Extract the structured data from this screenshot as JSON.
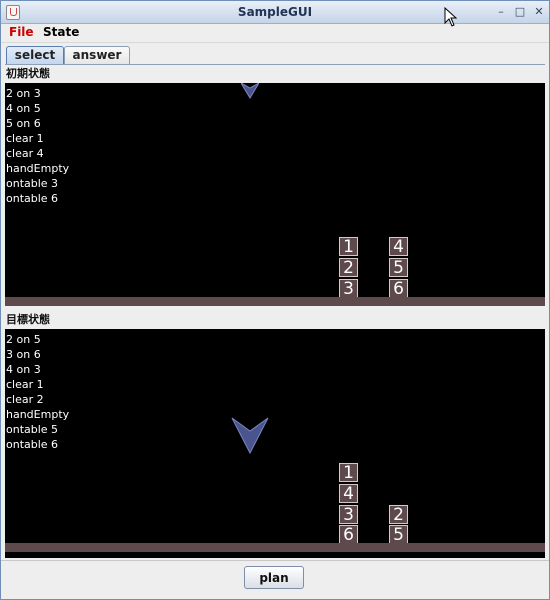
{
  "window": {
    "title": "SampleGUI",
    "minimize": "–",
    "maximize": "□",
    "close": "✕"
  },
  "menu": {
    "file": "File",
    "state": "State",
    "file_color": "#cc0000"
  },
  "tabs": {
    "select": "select",
    "answer": "answer"
  },
  "initial": {
    "label": "初期状態",
    "facts": [
      "2 on 3",
      "4 on 5",
      "5 on 6",
      "clear 1",
      "clear 4",
      "handEmpty",
      "ontable 3",
      "ontable 6"
    ],
    "stacks": [
      [
        "1",
        "2",
        "3"
      ],
      [
        "4",
        "5",
        "6"
      ]
    ]
  },
  "goal": {
    "label": "目標状態",
    "facts": [
      "2 on 5",
      "3 on 6",
      "4 on 3",
      "clear 1",
      "clear 2",
      "handEmpty",
      "ontable 5",
      "ontable 6"
    ],
    "stacks": [
      [
        "1",
        "4",
        "3",
        "6"
      ],
      [
        "2",
        "5"
      ]
    ]
  },
  "buttons": {
    "plan": "plan"
  },
  "colors": {
    "block": "#5e4a4d",
    "panel": "#000000",
    "hand": "#4a5590"
  }
}
